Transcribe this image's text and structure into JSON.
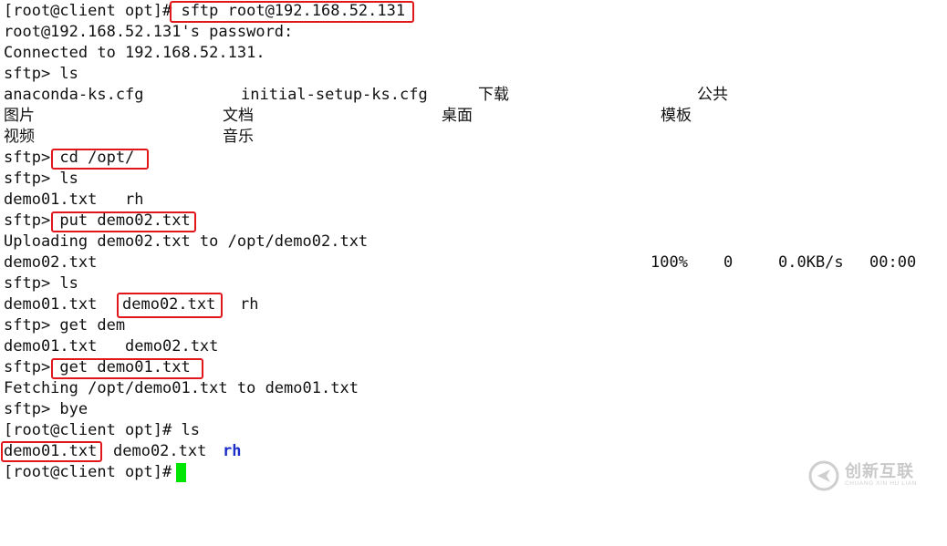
{
  "terminal": {
    "lines": {
      "l0": "[root@client opt]# sftp root@192.168.52.131",
      "l1": "root@192.168.52.131's password:",
      "l2": "Connected to 192.168.52.131.",
      "l3": "sftp> ls",
      "l4": {
        "c1": "anaconda-ks.cfg",
        "c2": "initial-setup-ks.cfg",
        "c3": "下载",
        "c4": "公共"
      },
      "l5": {
        "c1": "图片",
        "c2": "文档",
        "c3": "桌面",
        "c4": "模板"
      },
      "l6": {
        "c1": "视频",
        "c2": "音乐"
      },
      "l7": "sftp> cd /opt/",
      "l8": "sftp> ls",
      "l9": "demo01.txt   rh",
      "l10": "sftp> put demo02.txt",
      "l11": "Uploading demo02.txt to /opt/demo02.txt",
      "l12": {
        "file": "demo02.txt",
        "percent": "100%",
        "bytes": "0",
        "rate": "0.0KB/s",
        "eta": "00:00"
      },
      "l13": "sftp> ls",
      "l14": {
        "c1": "demo01.txt",
        "c2": "demo02.txt",
        "c3": "rh"
      },
      "l15": "sftp> get dem",
      "l16": "demo01.txt   demo02.txt",
      "l17": "sftp> get demo01.txt",
      "l18": "Fetching /opt/demo01.txt to demo01.txt",
      "l19": "sftp> bye",
      "l20": "[root@client opt]# ls",
      "l21": {
        "c1": "demo01.txt",
        "c2": "demo02.txt",
        "c3": "rh"
      },
      "l22": "[root@client opt]# "
    },
    "colors": {
      "highlight_border": "#e0181b",
      "cursor": "#00e600",
      "directory": "#1b2ec8",
      "text": "#111111",
      "background": "#ffffff"
    }
  },
  "watermark": {
    "name_cn": "创新互联",
    "name_en": "CHUANG XIN HU LIAN"
  }
}
